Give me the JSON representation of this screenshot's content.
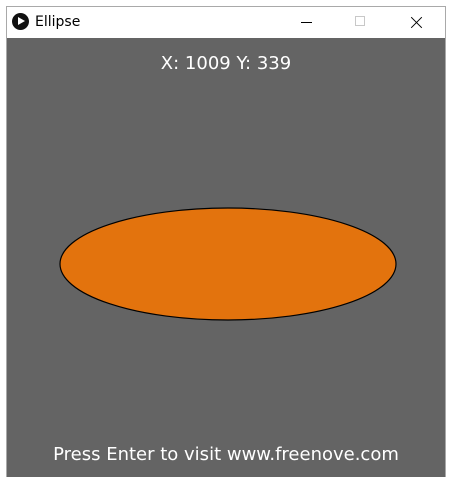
{
  "window": {
    "title": "Ellipse",
    "icon": "processing-play-icon",
    "controls": {
      "minimize": "minimize-icon",
      "maximize": "maximize-icon",
      "close": "close-icon"
    }
  },
  "canvas": {
    "background_color": "#646464",
    "coords_text": "X: 1009 Y: 339",
    "footer_text": "Press Enter to visit www.freenove.com",
    "shape": {
      "type": "ellipse",
      "fill_color": "#E3730D",
      "stroke_color": "#000000"
    }
  }
}
